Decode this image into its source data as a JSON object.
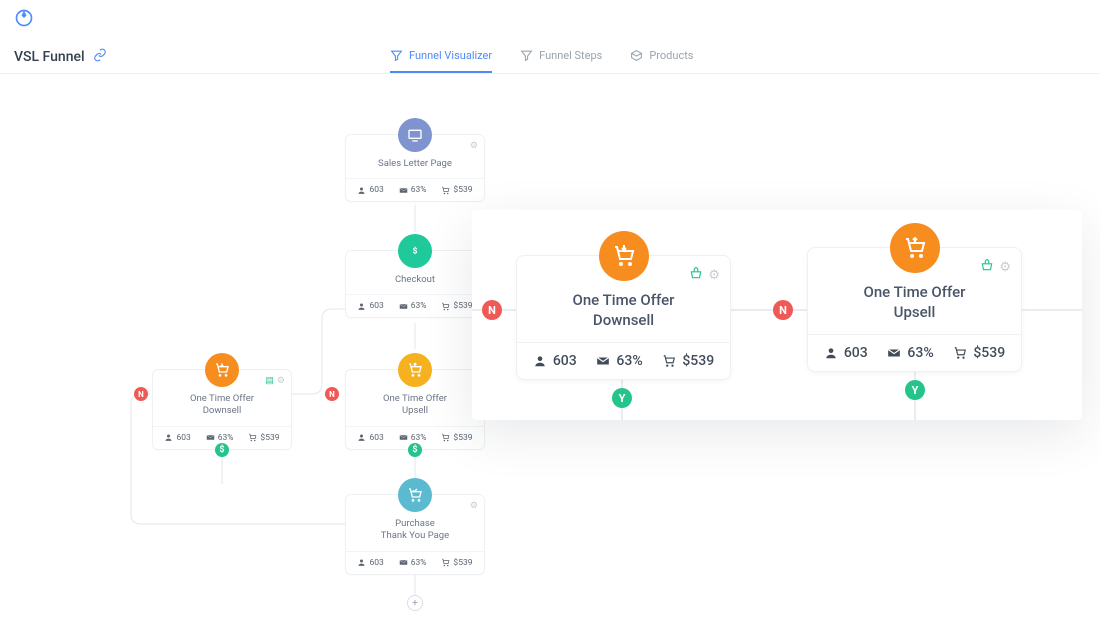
{
  "page": {
    "title": "VSL Funnel"
  },
  "tabs": {
    "visualizer": "Funnel Visualizer",
    "steps": "Funnel Steps",
    "products": "Products"
  },
  "badges": {
    "no": "N",
    "yes": "Y",
    "split": "$"
  },
  "nodes": {
    "sales_letter": {
      "title": "Sales Letter Page",
      "visitors": "603",
      "rate": "63%",
      "revenue": "$539"
    },
    "checkout": {
      "title": "Checkout",
      "visitors": "603",
      "rate": "63%",
      "revenue": "$539"
    },
    "downsell": {
      "title_l1": "One Time Offer",
      "title_l2": "Downsell",
      "visitors": "603",
      "rate": "63%",
      "revenue": "$539"
    },
    "upsell": {
      "title_l1": "One Time Offer",
      "title_l2": "Upsell",
      "visitors": "603",
      "rate": "63%",
      "revenue": "$539"
    },
    "thankyou": {
      "title_l1": "Purchase",
      "title_l2": "Thank You Page",
      "visitors": "603",
      "rate": "63%",
      "revenue": "$539"
    }
  },
  "zoom": {
    "downsell": {
      "title_l1": "One Time Offer",
      "title_l2": "Downsell",
      "visitors": "603",
      "rate": "63%",
      "revenue": "$539"
    },
    "upsell": {
      "title_l1": "One Time Offer",
      "title_l2": "Upsell",
      "visitors": "603",
      "rate": "63%",
      "revenue": "$539"
    }
  }
}
